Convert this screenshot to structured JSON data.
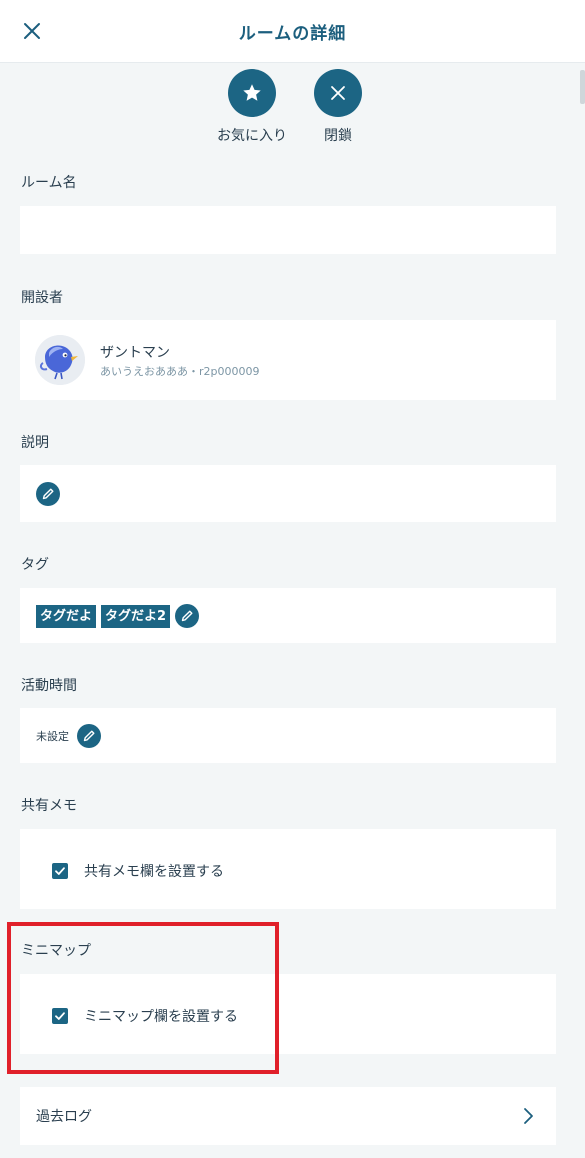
{
  "header": {
    "title": "ルームの詳細",
    "close_icon": "close-icon"
  },
  "actions": {
    "favorite_label": "お気に入り",
    "close_label": "閉鎖"
  },
  "room_name": {
    "label": "ルーム名",
    "value": ""
  },
  "creator": {
    "label": "開設者",
    "name": "ザントマン",
    "sub": "あいうえおあああ・r2p000009"
  },
  "description": {
    "label": "説明"
  },
  "tags": {
    "label": "タグ",
    "items": [
      "タグだよ",
      "タグだよ2"
    ]
  },
  "active_time": {
    "label": "活動時間",
    "value": "未設定"
  },
  "shared_memo": {
    "label": "共有メモ",
    "checkbox_label": "共有メモ欄を設置する",
    "checked": true
  },
  "minimap": {
    "label": "ミニマップ",
    "checkbox_label": "ミニマップ欄を設置する",
    "checked": true
  },
  "past_log": {
    "label": "過去ログ"
  },
  "colors": {
    "accent": "#1c6584",
    "highlight": "#e0202a"
  }
}
